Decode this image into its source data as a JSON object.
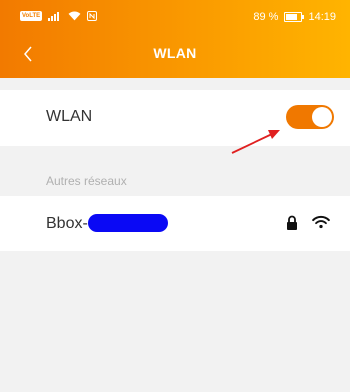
{
  "status_bar": {
    "volte_badge": "VoLTE",
    "battery_percent": "89 %",
    "time": "14:19"
  },
  "header": {
    "title": "WLAN"
  },
  "wlan_toggle_row": {
    "label": "WLAN",
    "toggle_on": true
  },
  "networks_section": {
    "header": "Autres réseaux",
    "networks": [
      {
        "name": "Bbox-",
        "secured": true,
        "signal": "wifi-icon"
      }
    ]
  },
  "colors": {
    "accent": "#f07800",
    "header_gradient_start": "#f27a00",
    "header_gradient_end": "#ffb400",
    "redaction": "#0a09f5",
    "annotation_arrow": "#e02020"
  }
}
